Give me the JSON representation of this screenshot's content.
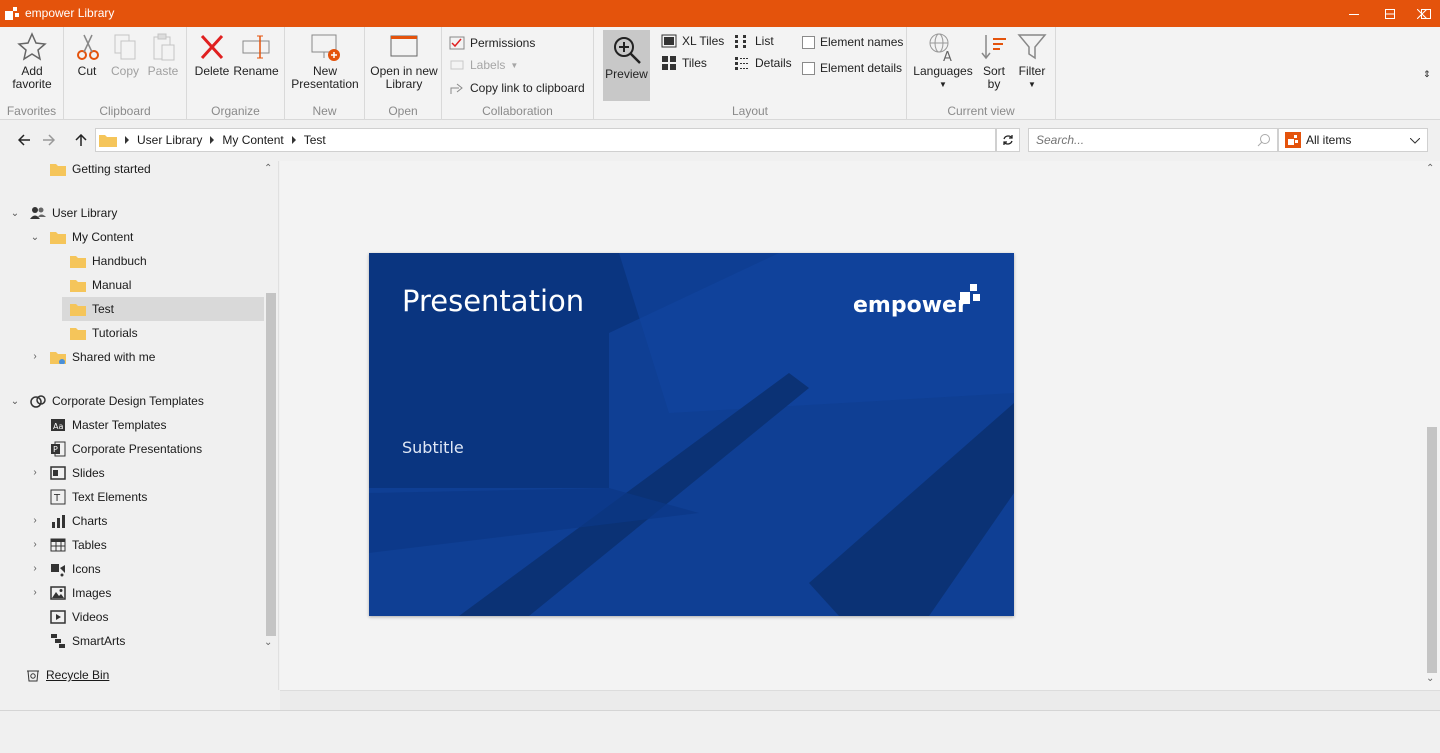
{
  "window": {
    "title": "empower Library",
    "accent": "#e4530c"
  },
  "ribbon": {
    "favorites": {
      "group_label": "Favorites",
      "add_favorite": "Add favorite"
    },
    "clipboard": {
      "group_label": "Clipboard",
      "cut": "Cut",
      "copy": "Copy",
      "paste": "Paste"
    },
    "organize": {
      "group_label": "Organize",
      "delete": "Delete",
      "rename": "Rename"
    },
    "new": {
      "group_label": "New",
      "new_presentation": "New Presentation"
    },
    "open": {
      "group_label": "Open",
      "open_new_library": "Open in new Library"
    },
    "collaboration": {
      "group_label": "Collaboration",
      "permissions": "Permissions",
      "labels": "Labels",
      "copy_link": "Copy link to clipboard"
    },
    "layout": {
      "group_label": "Layout",
      "preview": "Preview",
      "xl_tiles": "XL Tiles",
      "tiles": "Tiles",
      "list": "List",
      "details": "Details",
      "element_names": "Element names",
      "element_details": "Element details"
    },
    "current_view": {
      "group_label": "Current view",
      "languages": "Languages",
      "sort_by": "Sort by",
      "filter": "Filter"
    }
  },
  "address": {
    "breadcrumbs": [
      "User Library",
      "My Content",
      "Test"
    ],
    "search_placeholder": "Search...",
    "filter_selected": "All items"
  },
  "tree": {
    "getting_started": "Getting started",
    "user_library": "User Library",
    "my_content": "My Content",
    "handbuch": "Handbuch",
    "manual": "Manual",
    "test": "Test",
    "tutorials": "Tutorials",
    "shared_with_me": "Shared with me",
    "corporate_design_templates": "Corporate Design Templates",
    "master_templates": "Master Templates",
    "corporate_presentations": "Corporate Presentations",
    "slides": "Slides",
    "text_elements": "Text Elements",
    "charts": "Charts",
    "tables": "Tables",
    "icons": "Icons",
    "images": "Images",
    "videos": "Videos",
    "smartarts": "SmartArts",
    "recycle_bin": "Recycle Bin"
  },
  "preview": {
    "slide_title": "Presentation",
    "slide_subtitle": "Subtitle",
    "logo_text": "empower",
    "slide_bg": "#0d3a8a"
  }
}
